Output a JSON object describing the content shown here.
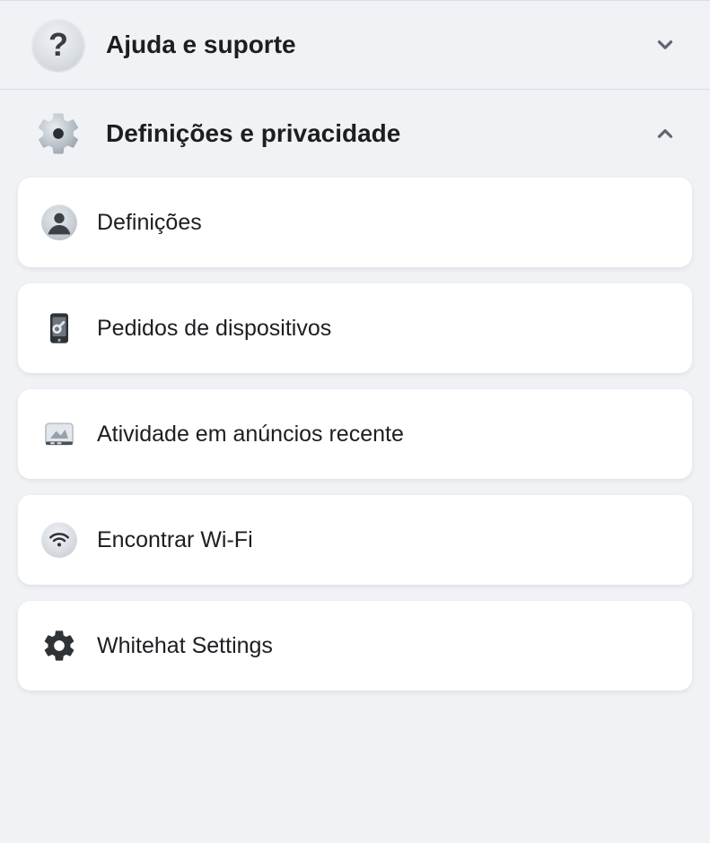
{
  "sections": {
    "help": {
      "label": "Ajuda e suporte",
      "expanded": false
    },
    "settings": {
      "label": "Definições e privacidade",
      "expanded": true,
      "items": [
        {
          "label": "Definições"
        },
        {
          "label": "Pedidos de dispositivos"
        },
        {
          "label": "Atividade em anúncios recente"
        },
        {
          "label": "Encontrar Wi-Fi"
        },
        {
          "label": "Whitehat Settings"
        }
      ]
    }
  }
}
